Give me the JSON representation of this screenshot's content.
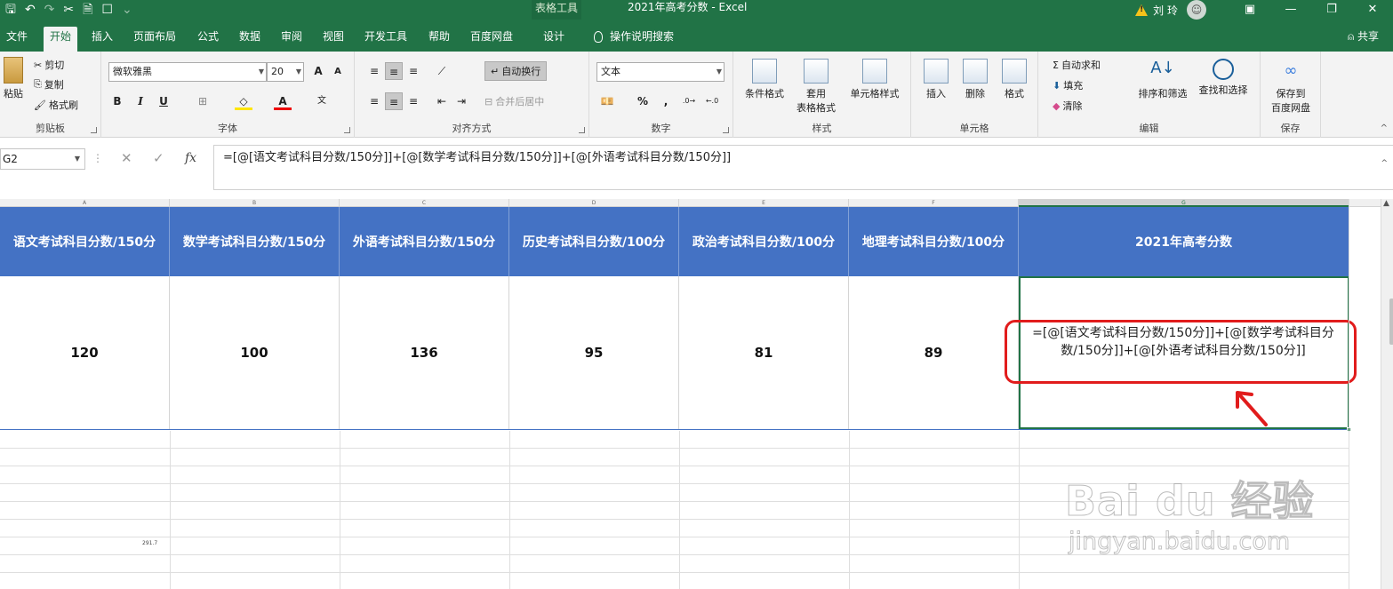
{
  "title_bar": {
    "context_tab": "表格工具",
    "document_title": "2021年高考分数 - Excel",
    "user_name": "刘 玲"
  },
  "menu": {
    "tabs": [
      "文件",
      "开始",
      "插入",
      "页面布局",
      "公式",
      "数据",
      "审阅",
      "视图",
      "开发工具",
      "帮助",
      "百度网盘",
      "设计"
    ],
    "active_tab": "开始",
    "tell_me": "操作说明搜索",
    "share": "共享"
  },
  "ribbon": {
    "clipboard": {
      "label": "剪贴板",
      "paste": "粘贴",
      "cut": "剪切",
      "copy": "复制",
      "format_painter": "格式刷"
    },
    "font": {
      "label": "字体",
      "font_name": "微软雅黑",
      "font_size": "20",
      "bold": "B",
      "italic": "I",
      "underline": "U"
    },
    "alignment": {
      "label": "对齐方式",
      "wrap_text": "自动换行",
      "merge_center": "合并后居中"
    },
    "number": {
      "label": "数字",
      "format": "文本",
      "percent": "%",
      "comma": ","
    },
    "styles": {
      "label": "样式",
      "conditional": "条件格式",
      "table_format_1": "套用",
      "table_format_2": "表格格式",
      "cell_styles": "单元格样式"
    },
    "cells": {
      "label": "单元格",
      "insert": "插入",
      "delete": "删除",
      "format": "格式"
    },
    "editing": {
      "label": "编辑",
      "autosum": "自动求和",
      "fill": "填充",
      "clear": "清除",
      "sort_filter": "排序和筛选",
      "find_select": "查找和选择"
    },
    "save": {
      "label": "保存",
      "save_to_1": "保存到",
      "save_to_2": "百度网盘"
    }
  },
  "formula_bar": {
    "name_box": "G2",
    "formula": "=[@[语文考试科目分数/150分]]+[@[数学考试科目分数/150分]]+[@[外语考试科目分数/150分]]"
  },
  "grid": {
    "column_letters": [
      "A",
      "B",
      "C",
      "D",
      "E",
      "F",
      "G"
    ],
    "headers": [
      "语文考试科目分数/150分",
      "数学考试科目分数/150分",
      "外语考试科目分数/150分",
      "历史考试科目分数/100分",
      "政治考试科目分数/100分",
      "地理考试科目分数/100分",
      "2021年高考分数"
    ],
    "row": [
      "120",
      "100",
      "136",
      "95",
      "81",
      "89"
    ],
    "active_cell_text": "=[@[语文考试科目分数/150分]]+[@[数学考试科目分数/150分]]+[@[外语考试科目分数/150分]]",
    "stray_value": "291.7"
  },
  "watermark": {
    "text": "Bai du 经验",
    "url": "jingyan.baidu.com"
  },
  "colors": {
    "excel_green": "#217346",
    "header_blue": "#4472c4",
    "callout_red": "#e11c1c"
  }
}
